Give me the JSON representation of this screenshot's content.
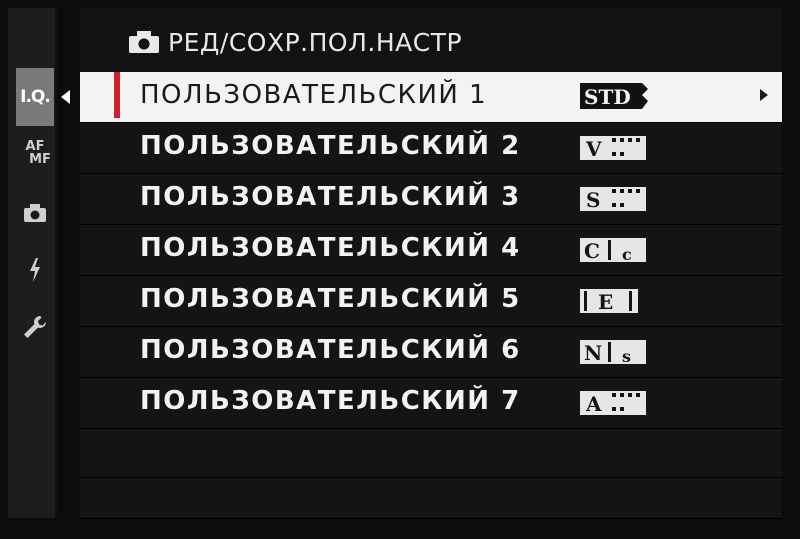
{
  "header": {
    "title": "РЕД/СОХР.ПОЛ.НАСТР",
    "icon": "camera-icon"
  },
  "sidebar": {
    "tabs": [
      {
        "label": "I.Q.",
        "active": true
      },
      {
        "label_top": "AF",
        "label_bottom": "MF"
      },
      {
        "icon": "camera-icon"
      },
      {
        "icon": "flash-icon"
      },
      {
        "icon": "wrench-icon"
      }
    ]
  },
  "menu": {
    "items": [
      {
        "label": "ПОЛЬЗОВАТЕЛЬСКИЙ 1",
        "sim": "STD",
        "selected": true
      },
      {
        "label": "ПОЛЬЗОВАТЕЛЬСКИЙ 2",
        "sim": "V"
      },
      {
        "label": "ПОЛЬЗОВАТЕЛЬСКИЙ 3",
        "sim": "S"
      },
      {
        "label": "ПОЛЬЗОВАТЕЛЬСКИЙ 4",
        "sim": "Cc"
      },
      {
        "label": "ПОЛЬЗОВАТЕЛЬСКИЙ 5",
        "sim": "E"
      },
      {
        "label": "ПОЛЬЗОВАТЕЛЬСКИЙ 6",
        "sim": "Ns"
      },
      {
        "label": "ПОЛЬЗОВАТЕЛЬСКИЙ 7",
        "sim": "A"
      }
    ]
  },
  "colors": {
    "accent": "#d21f2b",
    "selected_bg": "#f3f3f3",
    "row_bg": "#141414"
  }
}
